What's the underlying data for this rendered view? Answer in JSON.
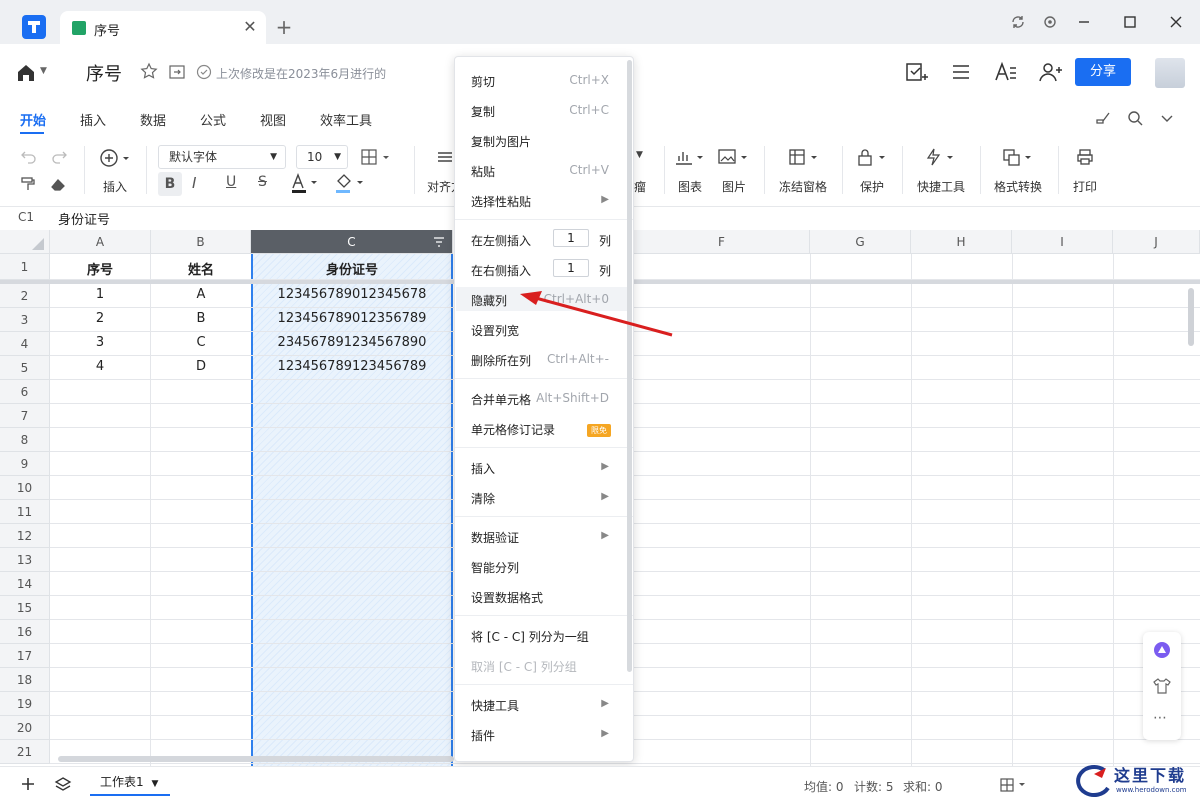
{
  "titlebar": {
    "tab_title": "序号",
    "new_tab": "+",
    "close": "✕"
  },
  "header": {
    "doc_name": "序号",
    "last_edit": "上次修改是在2023年6月进行的",
    "share": "分享"
  },
  "menu_tabs": [
    "开始",
    "插入",
    "数据",
    "公式",
    "视图",
    "效率工具"
  ],
  "toolbar": {
    "font": "默认字体",
    "font_size": "10",
    "insert_label": "插入",
    "align_label": "对齐方",
    "chart_label": "图表",
    "image_label": "图片",
    "freeze_label": "冻结窗格",
    "protect_label": "保护",
    "quick_label": "快捷工具",
    "convert_label": "格式转换",
    "print_label": "打印",
    "partial_label": "瘤"
  },
  "formula_bar": {
    "cell_ref": "C1",
    "value": "身份证号"
  },
  "grid": {
    "columns": [
      "A",
      "B",
      "C",
      "F",
      "G",
      "H",
      "I",
      "J"
    ],
    "rows": [
      "1",
      "2",
      "3",
      "4",
      "5",
      "6",
      "7",
      "8",
      "9",
      "10",
      "11",
      "12",
      "13",
      "14",
      "15",
      "16",
      "17",
      "18",
      "19",
      "20",
      "21"
    ],
    "header_row": [
      "序号",
      "姓名",
      "身份证号"
    ],
    "data": [
      [
        "1",
        "A",
        "123456789012345678"
      ],
      [
        "2",
        "B",
        "123456789012356789"
      ],
      [
        "3",
        "C",
        "234567891234567890"
      ],
      [
        "4",
        "D",
        "123456789123456789"
      ]
    ]
  },
  "context_menu": {
    "cut": "剪切",
    "cut_sc": "Ctrl+X",
    "copy": "复制",
    "copy_sc": "Ctrl+C",
    "copy_img": "复制为图片",
    "paste": "粘贴",
    "paste_sc": "Ctrl+V",
    "paste_special": "选择性粘贴",
    "insert_left": "在左侧插入",
    "insert_left_n": "1",
    "insert_right": "在右侧插入",
    "insert_right_n": "1",
    "col_unit": "列",
    "hide_col": "隐藏列",
    "hide_col_sc": "Ctrl+Alt+0",
    "set_width": "设置列宽",
    "delete_col": "删除所在列",
    "delete_col_sc": "Ctrl+Alt+-",
    "merge": "合并单元格",
    "merge_sc": "Alt+Shift+D",
    "revision": "单元格修订记录",
    "badge": "限免",
    "insert": "插入",
    "clear": "清除",
    "validate": "数据验证",
    "split": "智能分列",
    "format": "设置数据格式",
    "group": "将 [C - C] 列分为一组",
    "ungroup": "取消 [C - C] 列分组",
    "quick_tools": "快捷工具",
    "plugins": "插件"
  },
  "bottom": {
    "sheet": "工作表1",
    "avg": "均值: 0",
    "count": "计数: 5",
    "sum": "求和: 0",
    "watermark": "这里下载",
    "watermark_url": "www.herodown.com"
  },
  "colors": {
    "accent": "#1a6ef2",
    "selection": "#2f80ed",
    "arrow": "#d91f1f"
  }
}
